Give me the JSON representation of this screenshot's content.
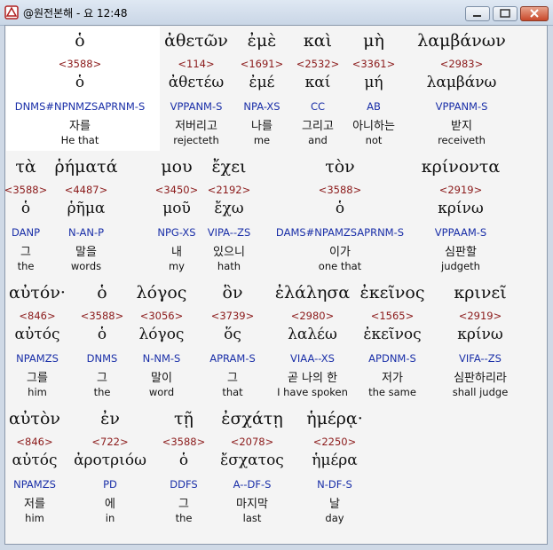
{
  "window": {
    "title": "@원전본해 - 요 12:48"
  },
  "colors": {
    "strong": "#8b1a1a",
    "morph": "#1a2fa8",
    "highlight": "#ffffff"
  },
  "words": [
    {
      "gk": "ὁ",
      "strong": "<3588>",
      "lemma": "ὁ",
      "morph": "DNMS#NPNMZSAPRNM-S",
      "kor": "자를",
      "eng": "He that"
    },
    {
      "gk": "ἀθετῶν",
      "strong": "<114>",
      "lemma": "ἀθετέω",
      "morph": "VPPANM-S",
      "kor": "저버리고",
      "eng": "rejecteth"
    },
    {
      "gk": "ἐμὲ",
      "strong": "<1691>",
      "lemma": "ἐμέ",
      "morph": "NPA-XS",
      "kor": "나를",
      "eng": "me"
    },
    {
      "gk": "καὶ",
      "strong": "<2532>",
      "lemma": "καί",
      "morph": "CC",
      "kor": "그리고",
      "eng": "and"
    },
    {
      "gk": "μὴ",
      "strong": "<3361>",
      "lemma": "μή",
      "morph": "AB",
      "kor": "아니하는",
      "eng": "not"
    },
    {
      "gk": "λαμβάνων",
      "strong": "<2983>",
      "lemma": "λαμβάνω",
      "morph": "VPPANM-S",
      "kor": "받지",
      "eng": "receiveth"
    },
    {
      "gk": "τὰ",
      "strong": "<3588>",
      "lemma": "ὁ",
      "morph": "DANP",
      "kor": "그",
      "eng": "the"
    },
    {
      "gk": "ῥήματά",
      "strong": "<4487>",
      "lemma": "ῥῆμα",
      "morph": "N-AN-P",
      "kor": "말을",
      "eng": "words"
    },
    {
      "gk": "μου",
      "strong": "<3450>",
      "lemma": "μοῦ",
      "morph": "NPG-XS",
      "kor": "내",
      "eng": "my"
    },
    {
      "gk": "ἔχει",
      "strong": "<2192>",
      "lemma": "ἔχω",
      "morph": "VIPA--ZS",
      "kor": "있으니",
      "eng": "hath"
    },
    {
      "gk": "τὸν",
      "strong": "<3588>",
      "lemma": "ὁ",
      "morph": "DAMS#NPAMZSAPRNM-S",
      "kor": "이가",
      "eng": "one that"
    },
    {
      "gk": "κρίνοντα",
      "strong": "<2919>",
      "lemma": "κρίνω",
      "morph": "VPPAAM-S",
      "kor": "심판할",
      "eng": "judgeth"
    },
    {
      "gk": "αὐτόν·",
      "strong": "<846>",
      "lemma": "αὐτός",
      "morph": "NPAMZS",
      "kor": "그를",
      "eng": "him"
    },
    {
      "gk": "ὁ",
      "strong": "<3588>",
      "lemma": "ὁ",
      "morph": "DNMS",
      "kor": "그",
      "eng": "the"
    },
    {
      "gk": "λόγος",
      "strong": "<3056>",
      "lemma": "λόγος",
      "morph": "N-NM-S",
      "kor": "말이",
      "eng": "word"
    },
    {
      "gk": "ὃν",
      "strong": "<3739>",
      "lemma": "ὅς",
      "morph": "APRAM-S",
      "kor": "그",
      "eng": "that"
    },
    {
      "gk": "ἐλάλησα",
      "strong": "<2980>",
      "lemma": "λαλέω",
      "morph": "VIAA--XS",
      "kor": "곧 나의 한",
      "eng": "I have spoken"
    },
    {
      "gk": "ἐκεῖνος",
      "strong": "<1565>",
      "lemma": "ἐκεῖνος",
      "morph": "APDNM-S",
      "kor": "저가",
      "eng": "the same"
    },
    {
      "gk": "κρινεῖ",
      "strong": "<2919>",
      "lemma": "κρίνω",
      "morph": "VIFA--ZS",
      "kor": "심판하리라",
      "eng": "shall judge"
    },
    {
      "gk": "αὐτὸν",
      "strong": "<846>",
      "lemma": "αὐτός",
      "morph": "NPAMZS",
      "kor": "저를",
      "eng": "him"
    },
    {
      "gk": "ἐν",
      "strong": "<722>",
      "lemma": "ἀροτριόω",
      "morph": "PD",
      "kor": "에",
      "eng": "in"
    },
    {
      "gk": "τῇ",
      "strong": "<3588>",
      "lemma": "ὁ",
      "morph": "DDFS",
      "kor": "그",
      "eng": "the"
    },
    {
      "gk": "ἐσχάτῃ",
      "strong": "<2078>",
      "lemma": "ἔσχατος",
      "morph": "A--DF-S",
      "kor": "마지막",
      "eng": "last"
    },
    {
      "gk": "ἡμέρᾳ·",
      "strong": "<2250>",
      "lemma": "ἡμέρα",
      "morph": "N-DF-S",
      "kor": "날",
      "eng": "day"
    }
  ]
}
